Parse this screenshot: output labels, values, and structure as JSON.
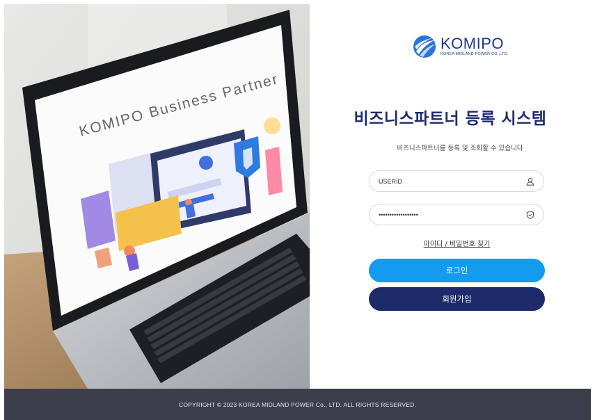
{
  "hero": {
    "screen_text": "KOMIPO Business Partner"
  },
  "logo": {
    "name": "KOMIPO",
    "sub": "KOREA MIDLAND POWER CO.,LTD."
  },
  "title": "비즈니스파트너 등록 시스템",
  "subtitle": "비즈니스파트너를 등록 및 조회할 수 있습니다",
  "form": {
    "userid_value": "USERID",
    "password_value": "••••••••••••••••••",
    "user_icon": "user-icon",
    "shield_icon": "shield-icon"
  },
  "find_link": "아이디 / 비밀번호 찾기",
  "buttons": {
    "login": "로그인",
    "join": "회원가입"
  },
  "colors": {
    "login": "#129bef",
    "join": "#1f2a6b",
    "title": "#1f2a6e",
    "footer": "#3c3e4b"
  },
  "footer": "COPYRIGHT © 2023 KOREA MIDLAND POWER Co., LTD. ALL RIGHTS RESERVED."
}
